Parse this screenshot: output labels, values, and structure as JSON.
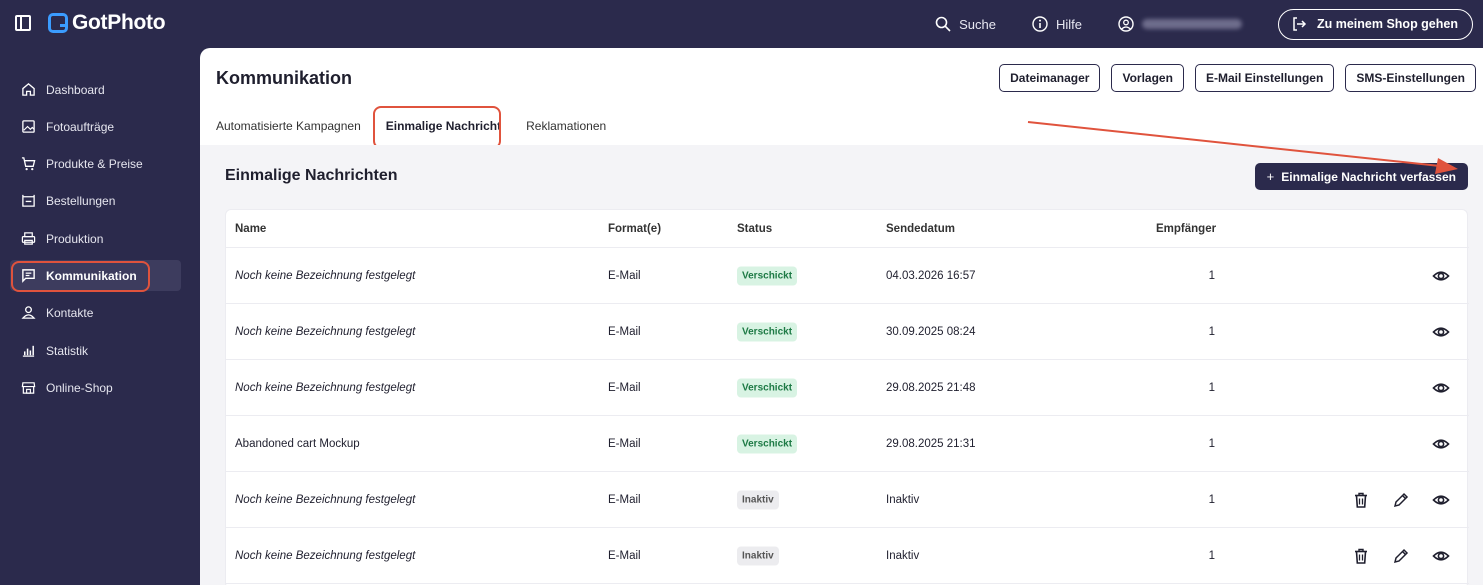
{
  "app": {
    "name": "GotPhoto"
  },
  "topbar": {
    "search_label": "Suche",
    "help_label": "Hilfe",
    "shop_button": "Zu meinem Shop gehen"
  },
  "sidebar": {
    "items": [
      {
        "label": "Dashboard",
        "icon": "home-icon",
        "active": false
      },
      {
        "label": "Fotoaufträge",
        "icon": "image-icon",
        "active": false
      },
      {
        "label": "Produkte & Preise",
        "icon": "cart-icon",
        "active": false
      },
      {
        "label": "Bestellungen",
        "icon": "box-icon",
        "active": false
      },
      {
        "label": "Produktion",
        "icon": "printer-icon",
        "active": false
      },
      {
        "label": "Kommunikation",
        "icon": "message-icon",
        "active": true
      },
      {
        "label": "Kontakte",
        "icon": "user-icon",
        "active": false
      },
      {
        "label": "Statistik",
        "icon": "chart-icon",
        "active": false
      },
      {
        "label": "Online-Shop",
        "icon": "store-icon",
        "active": false
      }
    ]
  },
  "page": {
    "title": "Kommunikation",
    "header_buttons": [
      "Dateimanager",
      "Vorlagen",
      "E-Mail Einstellungen",
      "SMS-Einstellungen"
    ],
    "tabs": [
      {
        "label": "Automatisierte Kampagnen",
        "active": false
      },
      {
        "label": "Einmalige Nachricht",
        "active": true
      },
      {
        "label": "Reklamationen",
        "active": false
      }
    ],
    "section_title": "Einmalige Nachrichten",
    "compose_button": "Einmalige Nachricht verfassen"
  },
  "table": {
    "columns": [
      "Name",
      "Format(e)",
      "Status",
      "Sendedatum",
      "Empfänger"
    ],
    "rows": [
      {
        "name": "Noch keine Bezeichnung festgelegt",
        "placeholder": true,
        "format": "E-Mail",
        "status": "Verschickt",
        "date": "04.03.2026 16:57",
        "recipients": "1",
        "editable": false
      },
      {
        "name": "Noch keine Bezeichnung festgelegt",
        "placeholder": true,
        "format": "E-Mail",
        "status": "Verschickt",
        "date": "30.09.2025 08:24",
        "recipients": "1",
        "editable": false
      },
      {
        "name": "Noch keine Bezeichnung festgelegt",
        "placeholder": true,
        "format": "E-Mail",
        "status": "Verschickt",
        "date": "29.08.2025 21:48",
        "recipients": "1",
        "editable": false
      },
      {
        "name": "Abandoned cart Mockup",
        "placeholder": false,
        "format": "E-Mail",
        "status": "Verschickt",
        "date": "29.08.2025 21:31",
        "recipients": "1",
        "editable": false
      },
      {
        "name": "Noch keine Bezeichnung festgelegt",
        "placeholder": true,
        "format": "E-Mail",
        "status": "Inaktiv",
        "date": "Inaktiv",
        "recipients": "1",
        "editable": true
      },
      {
        "name": "Noch keine Bezeichnung festgelegt",
        "placeholder": true,
        "format": "E-Mail",
        "status": "Inaktiv",
        "date": "Inaktiv",
        "recipients": "1",
        "editable": true
      }
    ]
  },
  "colors": {
    "navy": "#2b2a4c",
    "highlight": "#e0533d",
    "sent_badge_bg": "#d8f3e3",
    "sent_badge_text": "#1d7a45"
  }
}
